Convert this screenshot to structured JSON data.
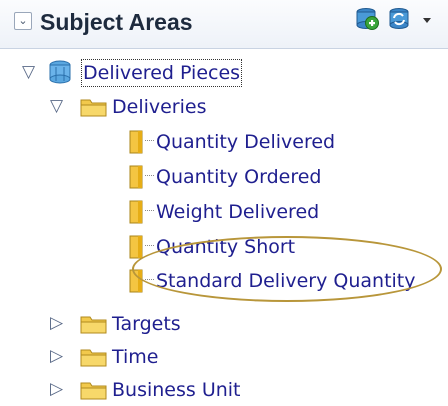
{
  "panel": {
    "title": "Subject Areas",
    "collapse_icon": "collapse-icon",
    "toolbar_icons": [
      "add-subject-area-icon",
      "refresh-icon",
      "chevron-down-icon"
    ]
  },
  "tree": {
    "root": {
      "label": "Delivered Pieces",
      "icon": "subject-area-icon",
      "expanded": true
    },
    "folders": [
      {
        "label": "Deliveries",
        "expanded": true,
        "columns": [
          "Quantity Delivered",
          "Quantity Ordered",
          "Weight Delivered",
          "Quantity Short",
          "Standard Delivery Quantity"
        ]
      },
      {
        "label": "Targets",
        "expanded": false
      },
      {
        "label": "Time",
        "expanded": false
      },
      {
        "label": "Business Unit",
        "expanded": false
      }
    ]
  },
  "annotation": {
    "highlighted_items": [
      "Quantity Short",
      "Standard Delivery Quantity"
    ],
    "color": "#b8963a"
  },
  "colors": {
    "text": "#1f1f8f",
    "folder": "#f2c94c",
    "column": "#f4c542"
  }
}
